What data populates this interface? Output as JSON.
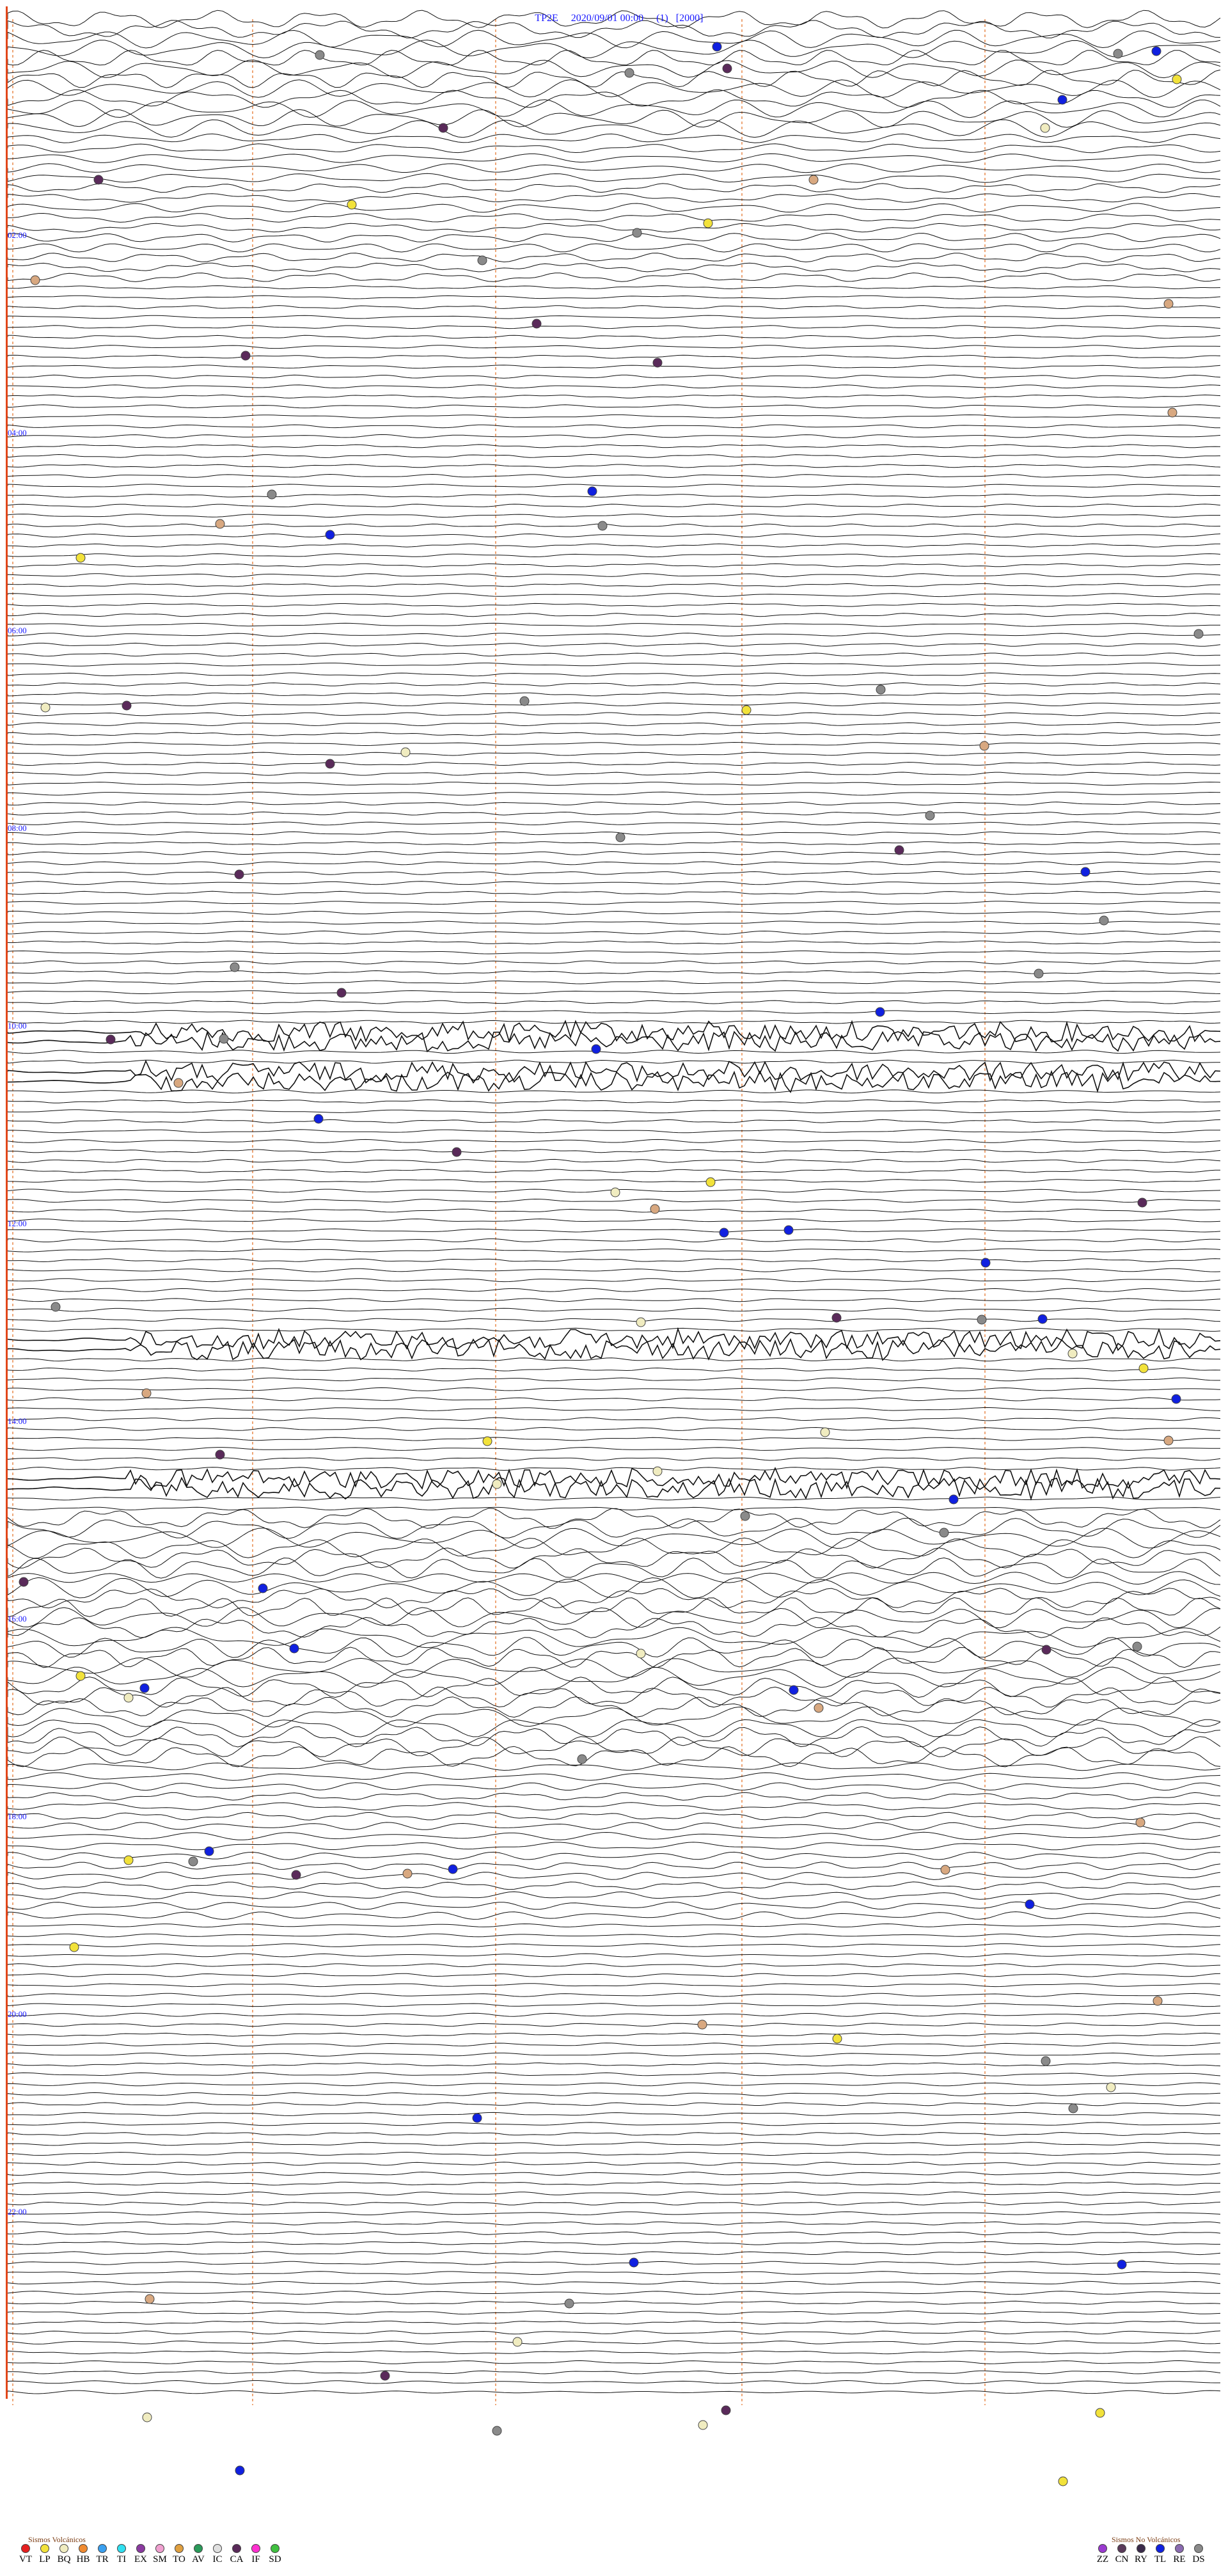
{
  "header": {
    "station": "TP2E",
    "datetime": "2020/09/01 00:00",
    "page": "(1)",
    "gain": "[2000]"
  },
  "hour_labels": [
    "02:00",
    "04:00",
    "06:00",
    "08:00",
    "10:00",
    "12:00",
    "14:00",
    "16:00",
    "18:00",
    "20:00",
    "22:00"
  ],
  "legend_volcanic": {
    "title": "Sismos Volcánicos",
    "items": [
      {
        "code": "VT",
        "color": "#e62020"
      },
      {
        "code": "LP",
        "color": "#f2e23a"
      },
      {
        "code": "BQ",
        "color": "#f0ecc0"
      },
      {
        "code": "HB",
        "color": "#f08a30"
      },
      {
        "code": "TR",
        "color": "#3aa0f0"
      },
      {
        "code": "TI",
        "color": "#30e0f0"
      },
      {
        "code": "EX",
        "color": "#8a3aa0"
      },
      {
        "code": "SM",
        "color": "#f0a0d0"
      },
      {
        "code": "TO",
        "color": "#e0a040"
      },
      {
        "code": "AV",
        "color": "#2a9a5a"
      },
      {
        "code": "IC",
        "color": "#e0e0e0"
      },
      {
        "code": "CA",
        "color": "#5a2a5a"
      },
      {
        "code": "IF",
        "color": "#ff30d0"
      },
      {
        "code": "SD",
        "color": "#40c040"
      }
    ]
  },
  "legend_nonvolcanic": {
    "title": "Sismos No Volcánicos",
    "items": [
      {
        "code": "ZZ",
        "color": "#9a3ad0"
      },
      {
        "code": "CN",
        "color": "#5a3a5a"
      },
      {
        "code": "RY",
        "color": "#3a2a4a"
      },
      {
        "code": "TL",
        "color": "#1020e0"
      },
      {
        "code": "RE",
        "color": "#8a6ab0"
      },
      {
        "code": "DS",
        "color": "#8a8a8a"
      }
    ]
  }
}
